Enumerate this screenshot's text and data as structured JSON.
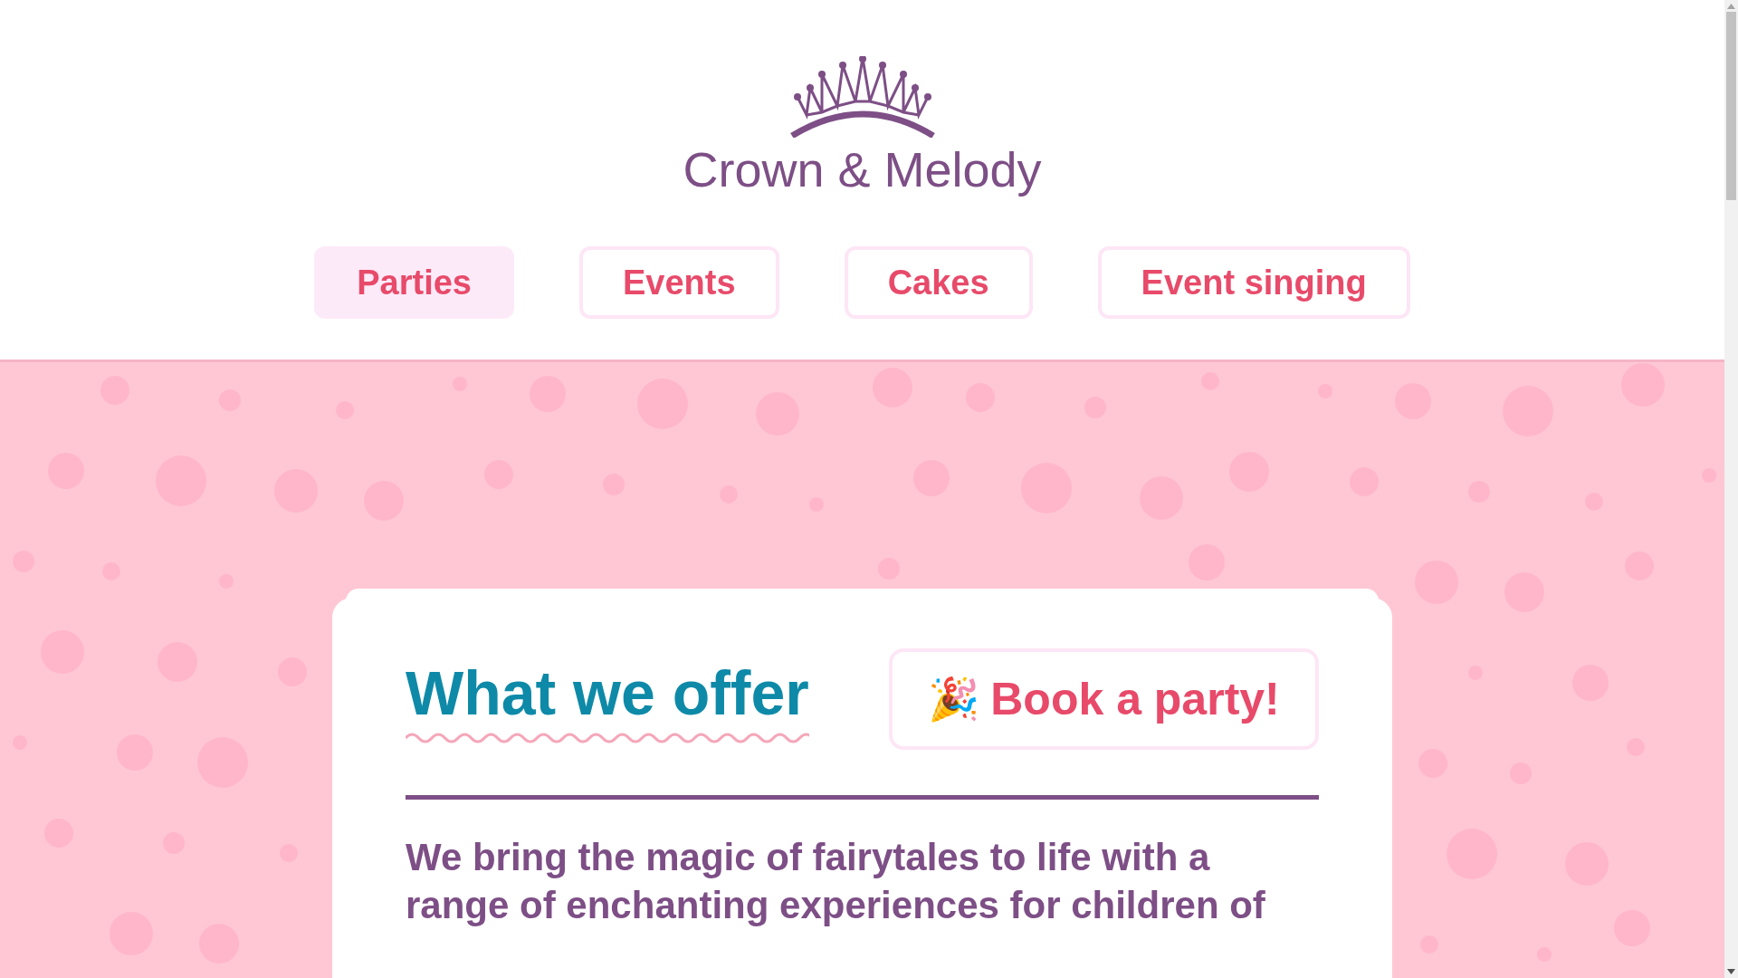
{
  "logo": {
    "text": "Crown & Melody"
  },
  "nav": [
    {
      "label": "Parties",
      "selected": true
    },
    {
      "label": "Events",
      "selected": false
    },
    {
      "label": "Cakes",
      "selected": false
    },
    {
      "label": "Event singing",
      "selected": false
    }
  ],
  "card": {
    "heading": "What we offer",
    "button": {
      "icon": "🎉",
      "label": "Book a party!"
    },
    "paragraph_lines": [
      "We bring the magic of fairytales to life with a",
      "range of enchanting experiences for children of"
    ]
  }
}
